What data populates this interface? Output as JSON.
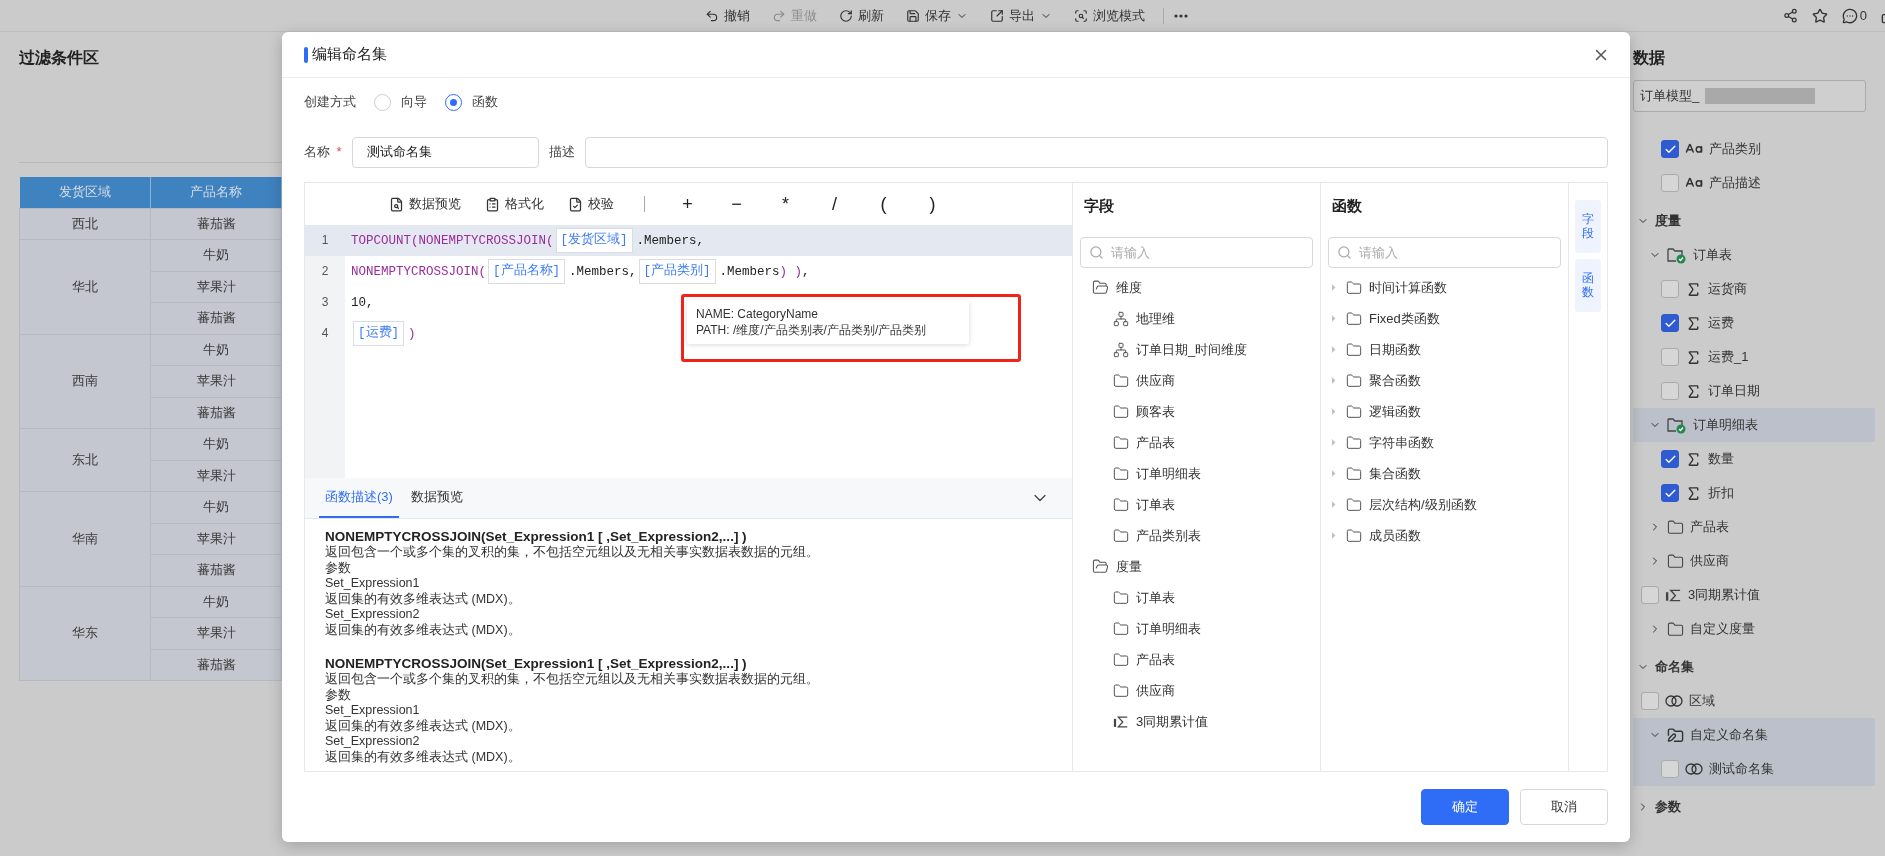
{
  "toolbar": {
    "actions": [
      {
        "label": "撤销",
        "kind": "undo",
        "disabled": false,
        "dropdown": false
      },
      {
        "label": "重做",
        "kind": "redo",
        "disabled": true,
        "dropdown": false
      },
      {
        "label": "刷新",
        "kind": "refresh",
        "disabled": false,
        "dropdown": false
      },
      {
        "label": "保存",
        "kind": "save",
        "disabled": false,
        "dropdown": true
      },
      {
        "label": "导出",
        "kind": "export",
        "disabled": false,
        "dropdown": true
      },
      {
        "label": "浏览模式",
        "kind": "preview",
        "disabled": false,
        "dropdown": false
      }
    ],
    "comment_count": "0"
  },
  "filter_panel": {
    "title": "过滤条件区",
    "table": {
      "columns": [
        "发货区域",
        "产品名称"
      ],
      "groups": [
        {
          "region": "西北",
          "products": [
            "蕃茄酱"
          ]
        },
        {
          "region": "华北",
          "products": [
            "牛奶",
            "苹果汁",
            "蕃茄酱"
          ]
        },
        {
          "region": "西南",
          "products": [
            "牛奶",
            "苹果汁",
            "蕃茄酱"
          ]
        },
        {
          "region": "东北",
          "products": [
            "牛奶",
            "苹果汁"
          ]
        },
        {
          "region": "华南",
          "products": [
            "牛奶",
            "苹果汁",
            "蕃茄酱"
          ]
        },
        {
          "region": "华东",
          "products": [
            "牛奶",
            "苹果汁",
            "蕃茄酱"
          ]
        }
      ]
    }
  },
  "data_panel": {
    "title": "数据",
    "model": "订单模型_",
    "tree": [
      {
        "kind": "text-field",
        "label": "产品类别",
        "checked": true,
        "selected": false
      },
      {
        "kind": "text-field",
        "label": "产品描述",
        "checked": false,
        "selected": false
      },
      {
        "kind": "section",
        "label": "度量",
        "expanded": true,
        "children": [
          {
            "kind": "table",
            "label": "订单表",
            "expanded": true,
            "selected": false,
            "children": [
              {
                "kind": "measure",
                "label": "运货商",
                "checked": false,
                "selected": false
              },
              {
                "kind": "measure",
                "label": "运费",
                "checked": true,
                "selected": false
              },
              {
                "kind": "measure",
                "label": "运费_1",
                "checked": false,
                "selected": false
              },
              {
                "kind": "measure",
                "label": "订单日期",
                "checked": false,
                "selected": false
              }
            ]
          },
          {
            "kind": "table",
            "label": "订单明细表",
            "expanded": true,
            "selected": true,
            "children": [
              {
                "kind": "measure",
                "label": "数量",
                "checked": true,
                "selected": false
              },
              {
                "kind": "measure",
                "label": "折扣",
                "checked": true,
                "selected": false
              }
            ]
          },
          {
            "kind": "folder",
            "label": "产品表",
            "expanded": false,
            "selected": false
          },
          {
            "kind": "folder",
            "label": "供应商",
            "expanded": false,
            "selected": false
          },
          {
            "kind": "calc",
            "label": "3同期累计值",
            "checked": false,
            "selected": false
          },
          {
            "kind": "folder",
            "label": "自定义度量",
            "expanded": false,
            "selected": false
          }
        ]
      },
      {
        "kind": "section",
        "label": "命名集",
        "expanded": true,
        "children": [
          {
            "kind": "set",
            "label": "区域",
            "checked": false,
            "selected": false
          },
          {
            "kind": "custom",
            "label": "自定义命名集",
            "expanded": true,
            "selected": true,
            "children": [
              {
                "kind": "set",
                "label": "测试命名集",
                "checked": false,
                "selected": true
              }
            ]
          }
        ]
      },
      {
        "kind": "section",
        "label": "参数",
        "expanded": false
      }
    ]
  },
  "dialog": {
    "title": "编辑命名集",
    "creation": {
      "label": "创建方式",
      "options": [
        {
          "label": "向导",
          "selected": false
        },
        {
          "label": "函数",
          "selected": true
        }
      ]
    },
    "name": {
      "label": "名称",
      "required": true,
      "value": "测试命名集"
    },
    "description": {
      "label": "描述"
    },
    "editor": {
      "tools": [
        {
          "label": "数据预览",
          "kind": "preview"
        },
        {
          "label": "格式化",
          "kind": "format"
        },
        {
          "label": "校验",
          "kind": "validate"
        }
      ],
      "operators": [
        "+",
        "−",
        "*",
        "/",
        "(",
        ")"
      ],
      "lines": [
        {
          "number": "1",
          "active": true,
          "tokens": [
            {
              "kind": "func",
              "text": "TOPCOUNT(NONEMPTYCROSSJOIN("
            },
            {
              "kind": "field",
              "text": "[发货区域]"
            },
            {
              "kind": "plain",
              "text": ".Members,"
            }
          ]
        },
        {
          "number": "2",
          "active": false,
          "tokens": [
            {
              "kind": "func",
              "text": "NONEMPTYCROSSJOIN("
            },
            {
              "kind": "field",
              "text": "[产品名称]"
            },
            {
              "kind": "plain",
              "text": ".Members,"
            },
            {
              "kind": "field",
              "text": "[产品类别]"
            },
            {
              "kind": "plain",
              "text": ".Members"
            },
            {
              "kind": "func",
              "text": ") )"
            },
            {
              "kind": "plain",
              "text": ","
            }
          ]
        },
        {
          "number": "3",
          "active": false,
          "tokens": [
            {
              "kind": "plain",
              "text": "10,"
            }
          ]
        },
        {
          "number": "4",
          "active": false,
          "tokens": [
            {
              "kind": "field",
              "text": "[运费]"
            },
            {
              "kind": "func",
              "text": ")"
            }
          ]
        }
      ],
      "tooltip": {
        "lines": [
          "NAME: CategoryName",
          "PATH: /维度/产品类别表/产品类别/产品类别"
        ]
      },
      "bottom_tabs": [
        {
          "label": "函数描述(3)",
          "selected": true
        },
        {
          "label": "数据预览",
          "selected": false
        }
      ],
      "descriptions": [
        {
          "title": "NONEMPTYCROSSJOIN(Set_Expression1 [ ,Set_Expression2,...] )",
          "lines": [
            "返回包含一个或多个集的叉积的集，不包括空元组以及无相关事实数据表数据的元组。",
            "参数",
            "Set_Expression1",
            "返回集的有效多维表达式 (MDX)。",
            "Set_Expression2",
            "返回集的有效多维表达式 (MDX)。"
          ]
        },
        {
          "title": "NONEMPTYCROSSJOIN(Set_Expression1 [ ,Set_Expression2,...] )",
          "lines": [
            "返回包含一个或多个集的叉积的集，不包括空元组以及无相关事实数据表数据的元组。",
            "参数",
            "Set_Expression1",
            "返回集的有效多维表达式 (MDX)。",
            "Set_Expression2",
            "返回集的有效多维表达式 (MDX)。"
          ]
        }
      ]
    },
    "fields": {
      "title": "字段",
      "placeholder": "请输入",
      "tree": [
        {
          "kind": "group",
          "label": "维度",
          "expanded": true,
          "children": [
            {
              "kind": "hierarchy",
              "label": "地理维"
            },
            {
              "kind": "hierarchy",
              "label": "订单日期_时间维度"
            },
            {
              "kind": "folder",
              "label": "供应商"
            },
            {
              "kind": "folder",
              "label": "顾客表"
            },
            {
              "kind": "folder",
              "label": "产品表"
            },
            {
              "kind": "folder",
              "label": "订单明细表"
            },
            {
              "kind": "folder",
              "label": "订单表"
            },
            {
              "kind": "folder",
              "label": "产品类别表"
            }
          ]
        },
        {
          "kind": "group",
          "label": "度量",
          "expanded": true,
          "children": [
            {
              "kind": "folder",
              "label": "订单表"
            },
            {
              "kind": "folder",
              "label": "订单明细表"
            },
            {
              "kind": "folder",
              "label": "产品表"
            },
            {
              "kind": "folder",
              "label": "供应商"
            },
            {
              "kind": "calc",
              "label": "3同期累计值"
            }
          ]
        }
      ]
    },
    "functions": {
      "title": "函数",
      "placeholder": "请输入",
      "items": [
        {
          "label": "时间计算函数",
          "expanded": false
        },
        {
          "label": "Fixed类函数",
          "expanded": false
        },
        {
          "label": "日期函数",
          "expanded": false
        },
        {
          "label": "聚合函数",
          "expanded": false
        },
        {
          "label": "逻辑函数",
          "expanded": false
        },
        {
          "label": "字符串函数",
          "expanded": false
        },
        {
          "label": "集合函数",
          "expanded": false
        },
        {
          "label": "层次结构/级别函数",
          "expanded": false
        },
        {
          "label": "成员函数",
          "expanded": false
        }
      ]
    },
    "side_tabs": [
      {
        "label": "字段",
        "selected": false
      },
      {
        "label": "函数",
        "selected": false
      }
    ],
    "buttons": [
      {
        "label": "确定",
        "kind": "primary"
      },
      {
        "label": "取消",
        "kind": "default"
      }
    ]
  }
}
